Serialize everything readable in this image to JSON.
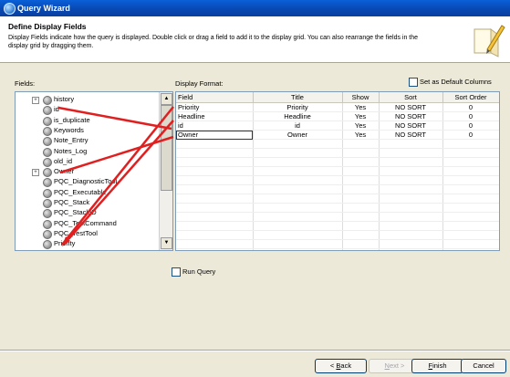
{
  "window": {
    "title": "Query Wizard"
  },
  "header": {
    "title": "Define Display Fields",
    "description": "Display Fields indicate how the query is displayed. Double click or drag a field to add it to the display grid. You can also rearrange the fields in the display grid by dragging them."
  },
  "fields": {
    "label": "Fields:",
    "items": [
      {
        "name": "history",
        "expandable": true
      },
      {
        "name": "id",
        "expandable": false
      },
      {
        "name": "is_duplicate",
        "expandable": false
      },
      {
        "name": "Keywords",
        "expandable": false
      },
      {
        "name": "Note_Entry",
        "expandable": false
      },
      {
        "name": "Notes_Log",
        "expandable": false
      },
      {
        "name": "old_id",
        "expandable": false
      },
      {
        "name": "Owner",
        "expandable": true
      },
      {
        "name": "PQC_DiagnosticTool",
        "expandable": false
      },
      {
        "name": "PQC_Executable",
        "expandable": false
      },
      {
        "name": "PQC_Stack",
        "expandable": false
      },
      {
        "name": "PQC_StackID",
        "expandable": false
      },
      {
        "name": "PQC_TestCommand",
        "expandable": false
      },
      {
        "name": "PQC_TestTool",
        "expandable": false
      },
      {
        "name": "Priority",
        "expandable": false
      }
    ]
  },
  "display": {
    "label": "Display Format:",
    "default_checkbox_label": "Set as Default Columns",
    "columns": [
      "Field",
      "Title",
      "Show",
      "Sort",
      "Sort Order"
    ],
    "rows": [
      [
        "Priority",
        "Priority",
        "Yes",
        "NO SORT",
        "0"
      ],
      [
        "Headline",
        "Headline",
        "Yes",
        "NO SORT",
        "0"
      ],
      [
        "id",
        "id",
        "Yes",
        "NO SORT",
        "0"
      ],
      [
        "Owner",
        "Owner",
        "Yes",
        "NO SORT",
        "0"
      ]
    ]
  },
  "run_query_label": "Run Query",
  "buttons": {
    "back": {
      "label": "< Back",
      "accel": "B"
    },
    "next": {
      "label": "Next >",
      "accel": "N"
    },
    "finish": {
      "label": "Finish",
      "accel": "F"
    },
    "cancel": {
      "label": "Cancel"
    }
  },
  "colors": {
    "annotation_arrow": "#e02020",
    "titlebar": "#0a5fd8"
  }
}
